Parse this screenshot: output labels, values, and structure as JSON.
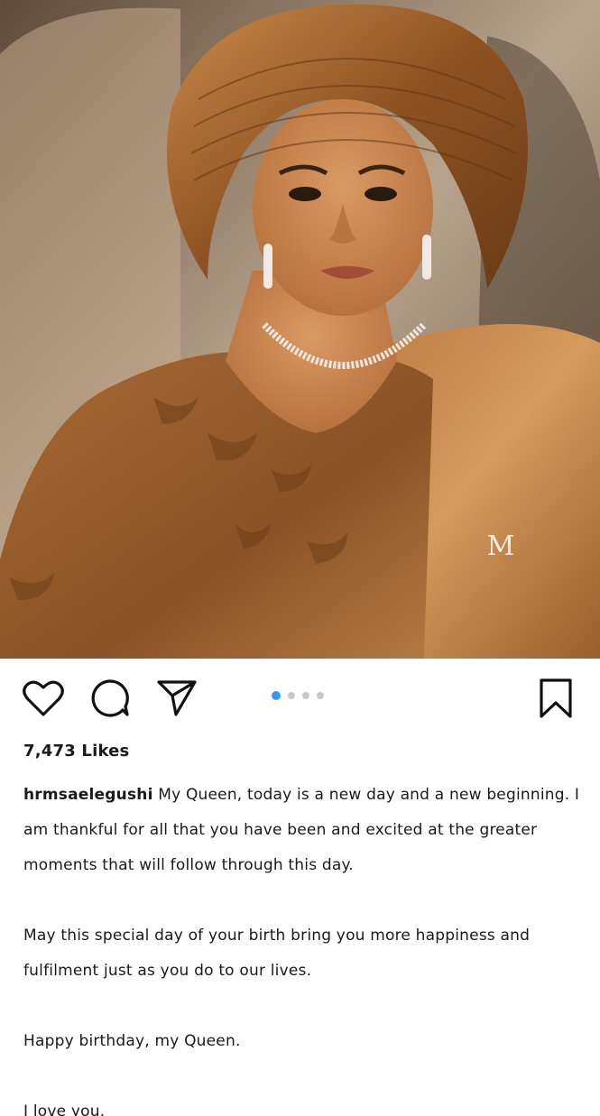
{
  "post": {
    "image_alt": "Portrait of a woman wearing a bronze gele headwrap, pearl necklace and bronze lace outfit",
    "watermark": "M",
    "carousel": {
      "count": 4,
      "active_index": 0
    },
    "likes": "7,473 Likes",
    "caption": {
      "username": "hrmsaelegushi",
      "para1": "My Queen, today is a new day and a new beginning. I am thankful for all that you have been and excited at the greater moments that will follow through this day.",
      "para2": "May this special day of your birth bring you more happiness and fulfilment just as you do to our lives.",
      "para3": "Happy birthday, my Queen.",
      "para4": "I love you."
    }
  },
  "icons": {
    "like": "heart-icon",
    "comment": "comment-icon",
    "share": "paper-plane-icon",
    "save": "bookmark-icon"
  },
  "colors": {
    "accent": "#3897f0",
    "dot_inactive": "#c8c8c8",
    "text": "#1a1a1a",
    "gele": "#9a5a2a"
  }
}
